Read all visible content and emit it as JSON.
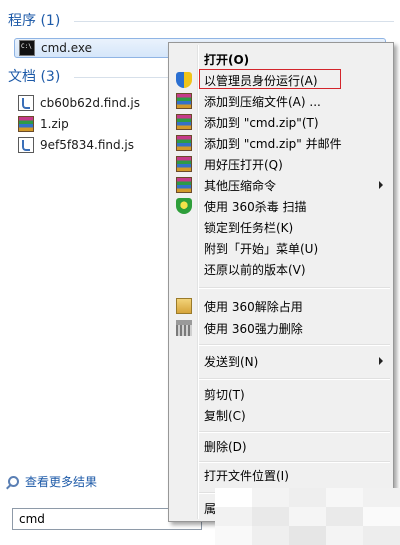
{
  "results": {
    "programs": {
      "header": "程序 (1)",
      "items": [
        {
          "name": "cmd.exe",
          "icon": "cmd-icon"
        }
      ]
    },
    "documents": {
      "header": "文档 (3)",
      "items": [
        {
          "name": "cb60b62d.find.js",
          "icon": "js-file-icon"
        },
        {
          "name": "1.zip",
          "icon": "zip-archive-icon"
        },
        {
          "name": "9ef5f834.find.js",
          "icon": "js-file-icon"
        }
      ]
    },
    "see_more": "查看更多结果"
  },
  "search": {
    "value": "cmd"
  },
  "context_menu": {
    "highlight_color": "#d3252b",
    "items": [
      {
        "label": "打开(O)",
        "bold": true
      },
      {
        "label": "以管理员身份运行(A)",
        "icon": "uac-shield-icon",
        "highlighted": true
      },
      {
        "label": "添加到压缩文件(A) ...",
        "icon": "winrar-icon"
      },
      {
        "label": "添加到 \"cmd.zip\"(T)",
        "icon": "winrar-icon"
      },
      {
        "label": "添加到 \"cmd.zip\" 并邮件",
        "icon": "winrar-icon"
      },
      {
        "label": "用好压打开(Q)",
        "icon": "winrar-icon"
      },
      {
        "label": "其他压缩命令",
        "icon": "winrar-icon",
        "submenu": true
      },
      {
        "label": "使用 360杀毒 扫描",
        "icon": "360-antivirus-icon"
      },
      {
        "label": "锁定到任务栏(K)"
      },
      {
        "label": "附到「开始」菜单(U)"
      },
      {
        "label": "还原以前的版本(V)"
      },
      {
        "label": "使用 360解除占用",
        "icon": "360-unlock-icon"
      },
      {
        "label": "使用 360强力删除",
        "icon": "360-shredder-icon"
      },
      {
        "label": "发送到(N)",
        "submenu": true
      },
      {
        "label": "剪切(T)"
      },
      {
        "label": "复制(C)"
      },
      {
        "label": "删除(D)"
      },
      {
        "label": "打开文件位置(I)"
      },
      {
        "label": "属"
      }
    ]
  }
}
